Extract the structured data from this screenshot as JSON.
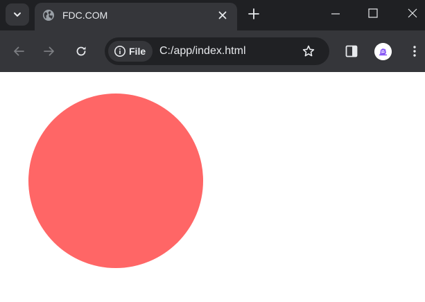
{
  "tab": {
    "title": "FDC.COM"
  },
  "address_bar": {
    "chip_label": "File",
    "url": "C:/app/index.html"
  },
  "icons": {
    "tab_search": "chevron-down-icon",
    "favicon": "globe-icon",
    "tab_close": "close-icon",
    "new_tab": "plus-icon",
    "back": "arrow-left-icon",
    "forward": "arrow-right-icon",
    "reload": "reload-icon",
    "site_info": "info-icon",
    "bookmark": "star-icon",
    "side_panel": "side-panel-icon",
    "profile": "avatar",
    "menu": "kebab-menu-icon"
  },
  "colors": {
    "tabstrip_bg": "#1f2023",
    "toolbar_bg": "#35363a",
    "omnibox_bg": "#202124",
    "text": "#e8eaed",
    "circle_fill": "#ff6666",
    "page_bg": "#ffffff"
  }
}
